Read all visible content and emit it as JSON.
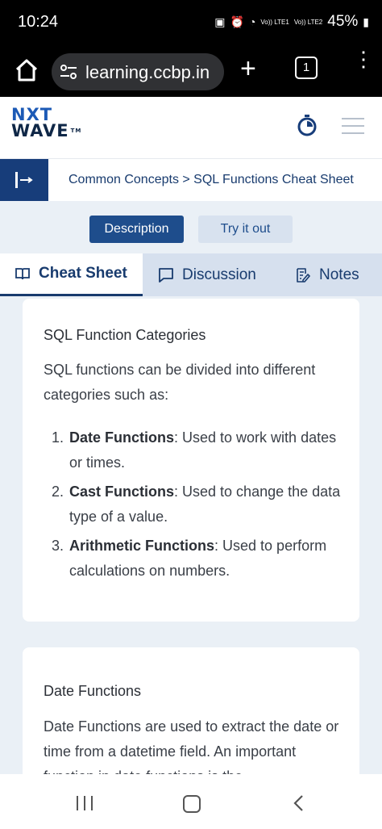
{
  "status_bar": {
    "time": "10:24",
    "battery": "45%",
    "net1": "Vo)) LTE1",
    "net2": "Vo)) LTE2"
  },
  "browser": {
    "url": "learning.ccbp.in",
    "tab_count": "1"
  },
  "header": {
    "logo_line1": "NXT",
    "logo_line2": "WAVE",
    "logo_tm": "TM"
  },
  "breadcrumb": {
    "text": "Common Concepts > SQL Functions Cheat Sheet"
  },
  "toggle_buttons": {
    "description": "Description",
    "try_it_out": "Try it out"
  },
  "tabs": {
    "cheat_sheet": "Cheat Sheet",
    "discussion": "Discussion",
    "notes": "Notes"
  },
  "card1": {
    "heading": "SQL Function Categories",
    "intro": "SQL functions can be divided into different categories such as:",
    "items": [
      {
        "num": "1.",
        "term": "Date Functions",
        "desc": ": Used to work with dates or times."
      },
      {
        "num": "2.",
        "term": "Cast Functions",
        "desc": ": Used to change the data type of a value."
      },
      {
        "num": "3.",
        "term": "Arithmetic Functions",
        "desc": ": Used to perform calculations on numbers."
      }
    ]
  },
  "card2": {
    "heading": "Date Functions",
    "intro": "Date Functions are used to extract the date or time from a datetime field. An important function in date functions is the"
  }
}
